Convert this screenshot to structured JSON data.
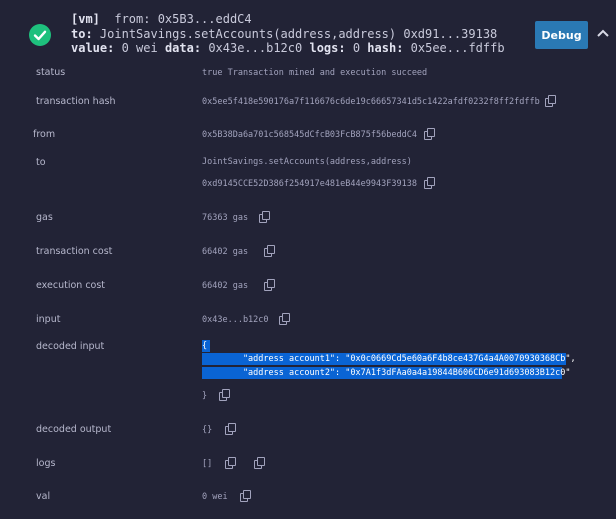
{
  "header": {
    "line1_tag": "[vm]",
    "line1_rest": "from: 0x5B3...eddC4",
    "line2_key": "to:",
    "line2_rest": "JointSavings.setAccounts(address,address) 0xd91...39138",
    "line3_k1": "value:",
    "line3_v1": "0 wei",
    "line3_k2": "data:",
    "line3_v2": "0x43e...b12c0",
    "line3_k3": "logs:",
    "line3_v3": "0",
    "line3_k4": "hash:",
    "line3_v4": "0x5ee...fdffb",
    "debug_label": "Debug",
    "status_icon": "check-circle-icon",
    "status_color": "#1ec07d",
    "accent_color": "#2a79b4"
  },
  "rows": {
    "status": {
      "label": "status",
      "value": "true Transaction mined and execution succeed"
    },
    "transaction_hash": {
      "label": "transaction hash",
      "value": "0x5ee5f418e590176a7f116676c6de19c66657341d5c1422afdf0232f8ff2fdffb"
    },
    "from": {
      "label": "from",
      "value": "0x5B38Da6a701c568545dCfcB03FcB875f56beddC4"
    },
    "to": {
      "label": "to",
      "value": "JointSavings.setAccounts(address,address)",
      "value2": "0xd9145CCE52D386f254917e481eB44e9943F39138"
    },
    "gas": {
      "label": "gas",
      "value": "76363 gas"
    },
    "transaction_cost": {
      "label": "transaction cost",
      "value": "66402 gas"
    },
    "execution_cost": {
      "label": "execution cost",
      "value": "66402 gas"
    },
    "input": {
      "label": "input",
      "value": "0x43e...b12c0"
    },
    "decoded_input": {
      "label": "decoded input",
      "open": "{",
      "line1": "        \"address account1\": \"0x0c0669Cd5e60a6F4b8ce437G4a4A0070930368Cb\",",
      "line2": "        \"address account2\": \"0x7A1f3dFAa0a4a19844B606CD6e91d693083B12c0\"",
      "close": "}"
    },
    "decoded_output": {
      "label": "decoded output",
      "value": "{}"
    },
    "logs": {
      "label": "logs",
      "value": "[]"
    },
    "val": {
      "label": "val",
      "value": "0 wei"
    }
  }
}
